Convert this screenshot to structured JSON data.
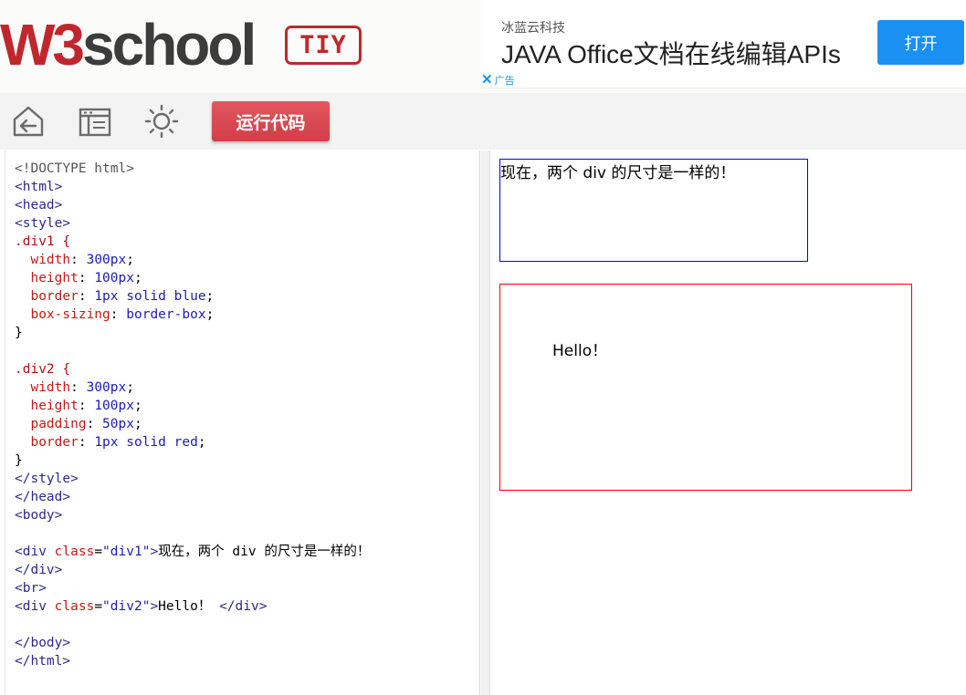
{
  "header": {
    "logo": {
      "w3": "W3",
      "school": "school"
    },
    "tiy_badge": "TIY"
  },
  "ad": {
    "company": "冰蓝云科技",
    "title": "JAVA Office文档在线编辑APIs",
    "open_button": "打开",
    "close_glyph": "✕",
    "ad_label": "广告"
  },
  "toolbar": {
    "icons": [
      "home-back-icon",
      "layout-icon",
      "brightness-icon"
    ],
    "run_button": "运行代码"
  },
  "code": {
    "lines": [
      "<!DOCTYPE html>",
      "<html>",
      "<head>",
      "<style>",
      ".div1 {",
      "  width: 300px;",
      "  height: 100px;",
      "  border: 1px solid blue;",
      "  box-sizing: border-box;",
      "}",
      "",
      ".div2 {",
      "  width: 300px;",
      "  height: 100px;",
      "  padding: 50px;",
      "  border: 1px solid red;",
      "}",
      "</style>",
      "</head>",
      "<body>",
      "",
      "<div class=\"div1\">现在，两个 div 的尺寸是一样的！",
      "</div>",
      "<br>",
      "<div class=\"div2\">Hello！ </div>",
      "",
      "</body>",
      "</html>"
    ]
  },
  "result": {
    "div1_text": "现在，两个 div 的尺寸是一样的！",
    "div2_text": "Hello！"
  },
  "colors": {
    "brand_red": "#c0272d",
    "ad_blue": "#1a90f3",
    "div1_border": "blue",
    "div2_border": "red"
  }
}
